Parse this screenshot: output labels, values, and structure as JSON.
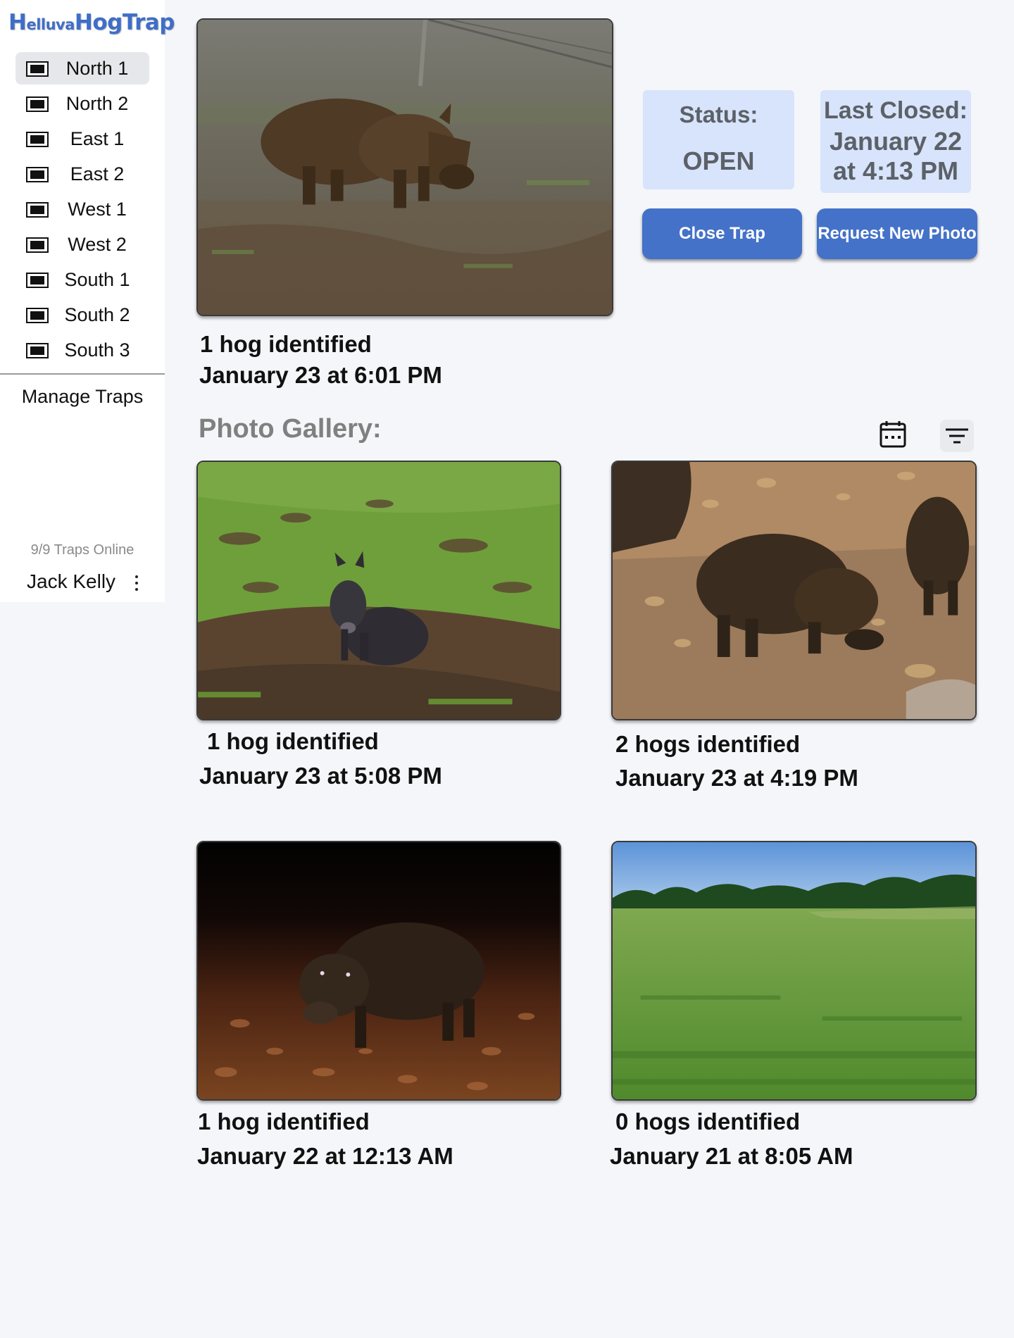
{
  "app": {
    "logo_big_1": "H",
    "logo_small_1": "elluva",
    "logo_big_2": "Hog",
    "logo_big_3": "Trap",
    "brand_color": "#3f6ec7"
  },
  "sidebar": {
    "traps": [
      {
        "label": "North 1",
        "selected": true
      },
      {
        "label": "North 2"
      },
      {
        "label": "East 1"
      },
      {
        "label": "East 2"
      },
      {
        "label": "West 1"
      },
      {
        "label": "West 2"
      },
      {
        "label": "South 1"
      },
      {
        "label": "South 2"
      },
      {
        "label": "South 3"
      }
    ],
    "trap_icon": "camera-monitor-icon",
    "manage_label": "Manage Traps",
    "online_status": "9/9 Traps Online",
    "user_name": "Jack Kelly",
    "user_menu_icon": "more-vertical-icon"
  },
  "current": {
    "photo_subject": "hog rooting in dry field",
    "hogs": "1 hog identified",
    "timestamp": "January 23 at 6:01 PM"
  },
  "status": {
    "label": "Status:",
    "value": "OPEN",
    "closed_label": "Last Closed:",
    "closed_line1": "January 22",
    "closed_line2": "at 4:13 PM",
    "card_color": "#d7e4fb"
  },
  "actions": {
    "close_label": "Close Trap",
    "request_label": "Request New Photo",
    "button_color": "#4472c8"
  },
  "gallery": {
    "title": "Photo Gallery:",
    "calendar_icon": "calendar-icon",
    "filter_icon": "filter-icon",
    "items": [
      {
        "hogs": "1 hog identified",
        "timestamp": "January 23 at 5:08 PM",
        "scene": "hog sitting on green grass"
      },
      {
        "hogs": "2 hogs identified",
        "timestamp": "January 23 at 4:19 PM",
        "scene": "two hogs on muddy ground"
      },
      {
        "hogs": "1 hog identified",
        "timestamp": "January 22 at 12:13 AM",
        "scene": "hog at night in leaves"
      },
      {
        "hogs": "0 hogs identified",
        "timestamp": "January 21 at 8:05 AM",
        "scene": "empty green pasture"
      }
    ]
  }
}
